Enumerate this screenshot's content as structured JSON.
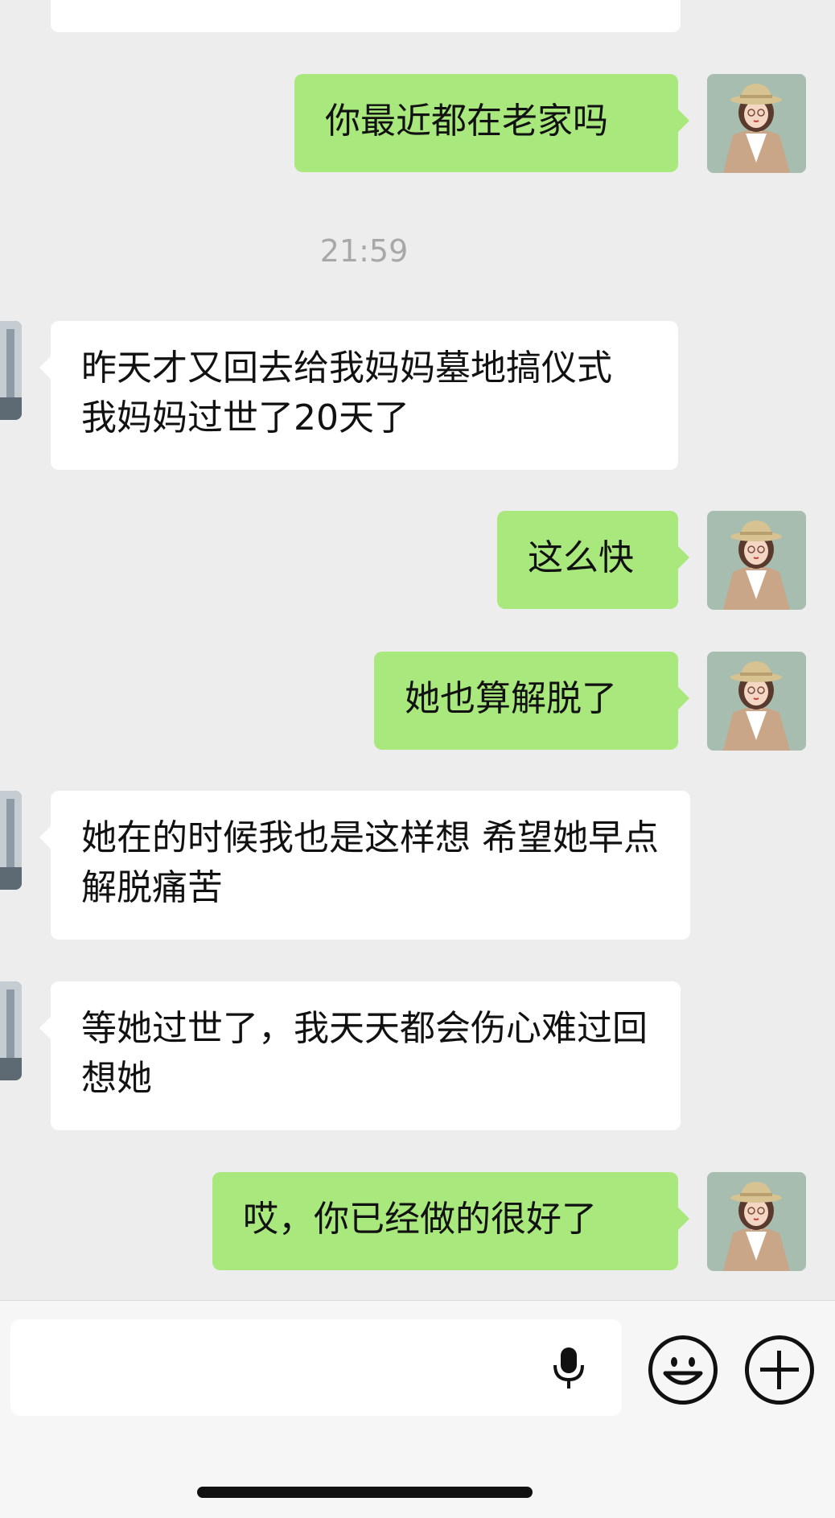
{
  "conversation": {
    "messages": [
      {
        "side": "in",
        "text": ""
      },
      {
        "side": "out",
        "text": "你最近都在老家吗"
      },
      {
        "side": "in",
        "text": "昨天才又回去给我妈妈墓地搞仪式 我妈妈过世了20天了"
      },
      {
        "side": "out",
        "text": "这么快"
      },
      {
        "side": "out",
        "text": "她也算解脱了"
      },
      {
        "side": "in",
        "text": "她在的时候我也是这样想 希望她早点解脱痛苦"
      },
      {
        "side": "in",
        "text": "等她过世了，我天天都会伤心难过回想她"
      },
      {
        "side": "out",
        "text": "哎，你已经做的很好了"
      }
    ],
    "timestamp": "21:59"
  },
  "input_bar": {
    "text_value": "",
    "icons": [
      "microphone-icon",
      "emoji-icon",
      "plus-icon"
    ]
  },
  "colors": {
    "background": "#ededed",
    "outgoing_bubble": "#a8e87c",
    "incoming_bubble": "#ffffff",
    "timestamp_text": "#a8a8a8"
  }
}
